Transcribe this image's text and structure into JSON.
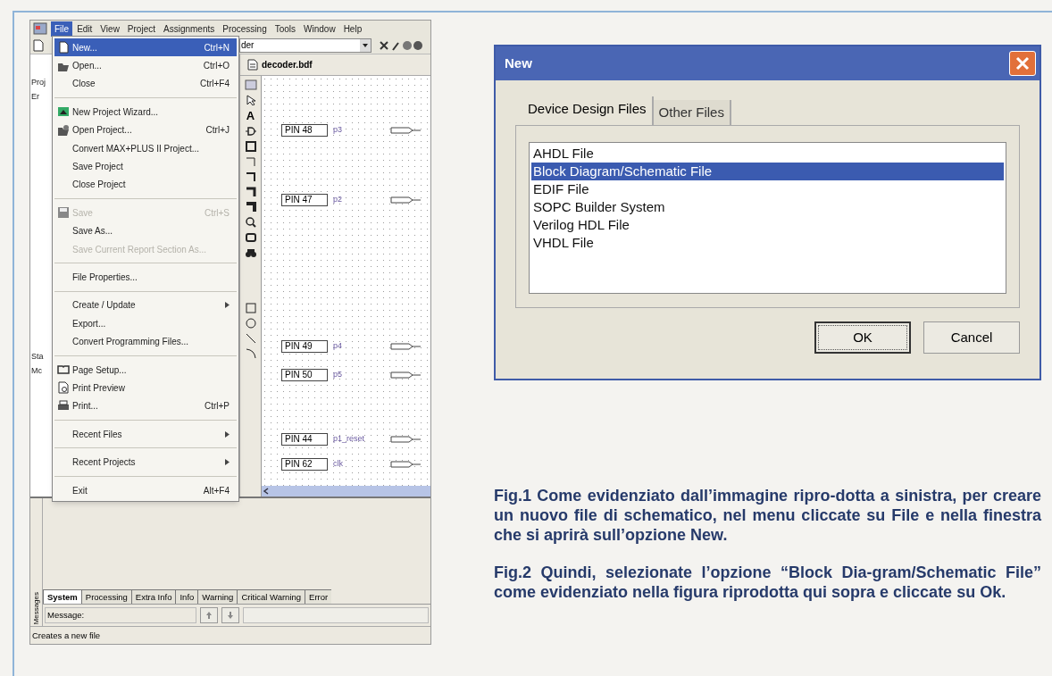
{
  "app_window": {
    "menu_bar": [
      {
        "label": "File",
        "selected": true
      },
      {
        "label": "Edit",
        "selected": false
      },
      {
        "label": "View",
        "selected": false
      },
      {
        "label": "Project",
        "selected": false
      },
      {
        "label": "Assignments",
        "selected": false
      },
      {
        "label": "Processing",
        "selected": false
      },
      {
        "label": "Tools",
        "selected": false
      },
      {
        "label": "Window",
        "selected": false
      },
      {
        "label": "Help",
        "selected": false
      }
    ],
    "project_combo": "der",
    "panel_fragments": [
      "Proj",
      "Er",
      "Sta",
      "Mc"
    ],
    "file_menu": [
      {
        "kind": "item",
        "label": "New...",
        "shortcut": "Ctrl+N",
        "selected": true,
        "disabled": false,
        "submenu": false
      },
      {
        "kind": "item",
        "label": "Open...",
        "shortcut": "Ctrl+O",
        "selected": false,
        "disabled": false,
        "submenu": false
      },
      {
        "kind": "item",
        "label": "Close",
        "shortcut": "Ctrl+F4",
        "selected": false,
        "disabled": false,
        "submenu": false
      },
      {
        "kind": "separator"
      },
      {
        "kind": "item",
        "label": "New Project Wizard...",
        "selected": false,
        "disabled": false,
        "submenu": false
      },
      {
        "kind": "item",
        "label": "Open Project...",
        "shortcut": "Ctrl+J",
        "selected": false,
        "disabled": false,
        "submenu": false
      },
      {
        "kind": "item",
        "label": "Convert MAX+PLUS II Project...",
        "selected": false,
        "disabled": false,
        "submenu": false
      },
      {
        "kind": "item",
        "label": "Save Project",
        "selected": false,
        "disabled": false,
        "submenu": false
      },
      {
        "kind": "item",
        "label": "Close Project",
        "selected": false,
        "disabled": false,
        "submenu": false
      },
      {
        "kind": "separator"
      },
      {
        "kind": "item",
        "label": "Save",
        "shortcut": "Ctrl+S",
        "selected": false,
        "disabled": true,
        "submenu": false
      },
      {
        "kind": "item",
        "label": "Save As...",
        "selected": false,
        "disabled": false,
        "submenu": false
      },
      {
        "kind": "item",
        "label": "Save Current Report Section As...",
        "selected": false,
        "disabled": true,
        "submenu": false
      },
      {
        "kind": "separator"
      },
      {
        "kind": "item",
        "label": "File Properties...",
        "selected": false,
        "disabled": false,
        "submenu": false
      },
      {
        "kind": "separator"
      },
      {
        "kind": "item",
        "label": "Create / Update",
        "selected": false,
        "disabled": false,
        "submenu": true
      },
      {
        "kind": "item",
        "label": "Export...",
        "selected": false,
        "disabled": false,
        "submenu": false
      },
      {
        "kind": "item",
        "label": "Convert Programming Files...",
        "selected": false,
        "disabled": false,
        "submenu": false
      },
      {
        "kind": "separator"
      },
      {
        "kind": "item",
        "label": "Page Setup...",
        "selected": false,
        "disabled": false,
        "submenu": false
      },
      {
        "kind": "item",
        "label": "Print Preview",
        "selected": false,
        "disabled": false,
        "submenu": false
      },
      {
        "kind": "item",
        "label": "Print...",
        "shortcut": "Ctrl+P",
        "selected": false,
        "disabled": false,
        "submenu": false
      },
      {
        "kind": "separator"
      },
      {
        "kind": "item",
        "label": "Recent Files",
        "selected": false,
        "disabled": false,
        "submenu": true
      },
      {
        "kind": "separator"
      },
      {
        "kind": "item",
        "label": "Recent Projects",
        "selected": false,
        "disabled": false,
        "submenu": true
      },
      {
        "kind": "separator"
      },
      {
        "kind": "item",
        "label": "Exit",
        "shortcut": "Alt+F4",
        "selected": false,
        "disabled": false,
        "submenu": false
      }
    ],
    "document_tab": "decoder.bdf",
    "text_tool": "A",
    "pins": [
      {
        "pin": "PIN 48",
        "net": "p3"
      },
      {
        "pin": "PIN 47",
        "net": "p2"
      },
      {
        "pin": "PIN 49",
        "net": "p4"
      },
      {
        "pin": "PIN 50",
        "net": "p5"
      },
      {
        "pin": "PIN 44",
        "net": "p1_reset"
      },
      {
        "pin": "PIN 62",
        "net": "clk"
      }
    ],
    "messages_label": "Messages",
    "message_tabs": [
      {
        "label": "System",
        "selected": true
      },
      {
        "label": "Processing",
        "selected": false
      },
      {
        "label": "Extra Info",
        "selected": false
      },
      {
        "label": "Info",
        "selected": false
      },
      {
        "label": "Warning",
        "selected": false
      },
      {
        "label": "Critical Warning",
        "selected": false
      },
      {
        "label": "Error",
        "selected": false
      }
    ],
    "message_label": "Message:",
    "status_bar": "Creates a new file"
  },
  "new_dialog": {
    "title": "New",
    "tabs": [
      {
        "label": "Device Design Files",
        "selected": true
      },
      {
        "label": "Other Files",
        "selected": false
      }
    ],
    "file_types": [
      {
        "label": "AHDL File",
        "selected": false
      },
      {
        "label": "Block Diagram/Schematic File",
        "selected": true
      },
      {
        "label": "EDIF File",
        "selected": false
      },
      {
        "label": "SOPC Builder System",
        "selected": false
      },
      {
        "label": "Verilog HDL File",
        "selected": false
      },
      {
        "label": "VHDL File",
        "selected": false
      }
    ],
    "buttons": [
      "OK",
      "Cancel"
    ]
  },
  "captions": [
    "Fig.1 Come evidenziato dall’immagine ripro-dotta a sinistra, per creare un nuovo file di schematico, nel menu cliccate su File e nella finestra che si aprirà sull’opzione New.",
    "Fig.2 Quindi, selezionate l’opzione “Block Dia-gram/Schematic File” come evidenziato nella figura riprodotta qui sopra e cliccate su Ok."
  ]
}
